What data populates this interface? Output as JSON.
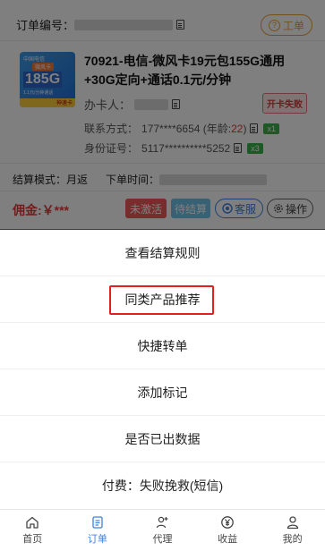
{
  "order": {
    "number_label": "订单编号：",
    "ticket_label": "工单",
    "ticket_icon": "question-mark",
    "product_image": {
      "brand": "中国电信",
      "tag": "微风卡",
      "big": "185G",
      "small": "1.1元/分钟通话",
      "bottom": "神速卡"
    },
    "product_title": "70921-电信-微风卡19元包155G通用+30G定向+通话0.1元/分钟",
    "handler_label": "办卡人：",
    "fail_badge": "开卡失败",
    "contact_label": "联系方式：",
    "contact_value": "177****6654 (年龄:",
    "age_value": "22",
    "contact_suffix": ")",
    "contact_badge": "x1",
    "id_label": "身份证号：",
    "id_value": "5117**********5252",
    "id_badge": "x3",
    "settle_label": "结算模式：月返",
    "order_time_label": "下单时间：",
    "commission": "佣金:￥***",
    "status_inactive": "未激活",
    "status_pending": "待结算",
    "service_label": "客服",
    "ops_label": "操作"
  },
  "sheet": {
    "items": [
      "查看结算规则",
      "同类产品推荐",
      "快捷转单",
      "添加标记",
      "是否已出数据",
      "付费：失败挽救(短信)"
    ]
  },
  "tabbar": {
    "items": [
      {
        "label": "首页",
        "icon": "home-icon"
      },
      {
        "label": "订单",
        "icon": "order-icon"
      },
      {
        "label": "代理",
        "icon": "add-user-icon"
      },
      {
        "label": "收益",
        "icon": "yen-icon"
      },
      {
        "label": "我的",
        "icon": "user-icon"
      }
    ],
    "active_index": 1
  },
  "colors": {
    "accent": "#3d7fe0",
    "danger": "#e23a3a",
    "highlight_border": "#e4201e",
    "warning": "#e6a23c"
  }
}
